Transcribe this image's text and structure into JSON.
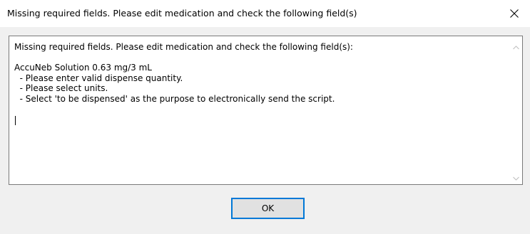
{
  "window": {
    "title": "Missing required fields. Please edit medication and check the following field(s)",
    "close_icon": "close-icon"
  },
  "message": {
    "lines": [
      "Missing required fields. Please edit medication and check the following field(s):",
      "",
      "AccuNeb Solution 0.63 mg/3 mL",
      "  - Please enter valid dispense quantity.",
      "  - Please select units.",
      "  - Select 'to be dispensed' as the purpose to electronically send the script."
    ]
  },
  "scrollbar": {
    "up_icon": "chevron-up-icon",
    "down_icon": "chevron-down-icon"
  },
  "buttons": {
    "ok_label": "OK"
  },
  "colors": {
    "dialog_background": "#f0f0f0",
    "titlebar_background": "#ffffff",
    "button_focus_border": "#0078d7",
    "button_background": "#e1e1e1"
  }
}
